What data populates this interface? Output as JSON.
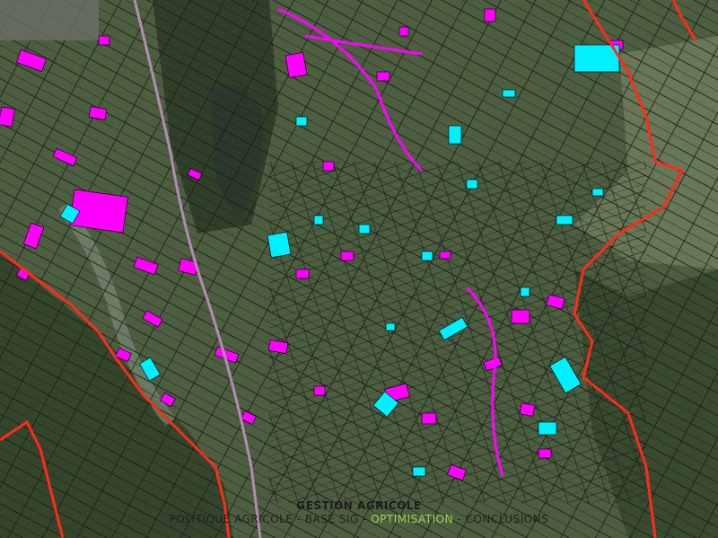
{
  "map": {
    "legend_colors": {
      "parcel_highlight_a": "#ff00ff",
      "parcel_highlight_b": "#00f0ff",
      "boundary": "#ff2a1a",
      "parcel_outline": "#000000"
    }
  },
  "caption": {
    "title": "GESTION AGRICOLE",
    "nav": [
      {
        "label": "POLITIQUE AGRICOLE",
        "active": false
      },
      {
        "label": "BASE SIG",
        "active": false
      },
      {
        "label": "OPTIMISATION",
        "active": true
      },
      {
        "label": "CONCLUSIONS",
        "active": false
      }
    ]
  }
}
